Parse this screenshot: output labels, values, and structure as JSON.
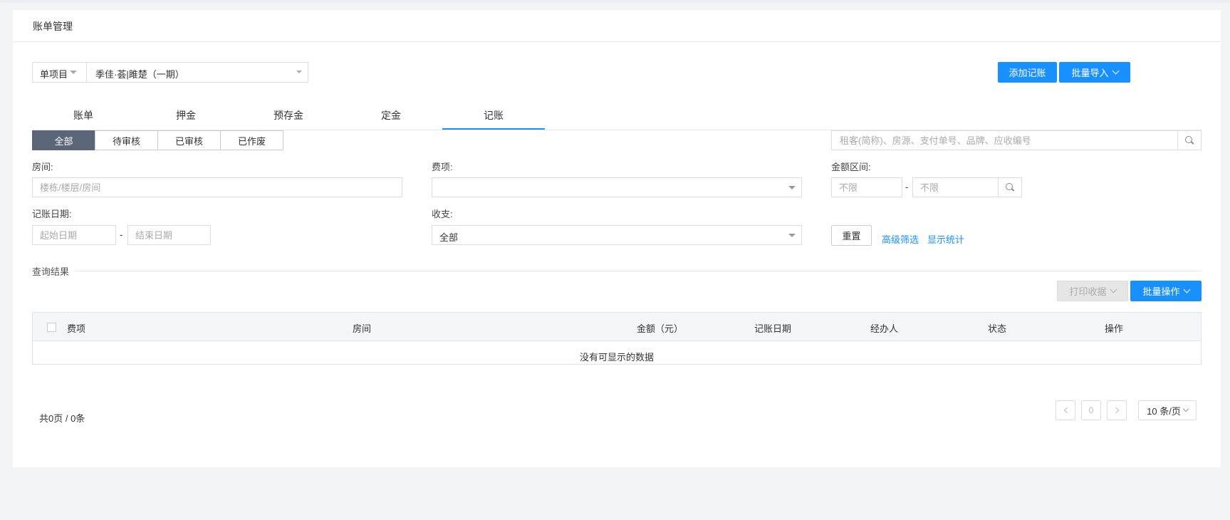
{
  "card": {
    "title": "账单管理"
  },
  "project": {
    "type": "单项目",
    "value": "季佳·荟|雎楚（一期）"
  },
  "actions": {
    "add_record": "添加记账",
    "batch_import": "批量导入"
  },
  "tabs": [
    {
      "label": "账单",
      "active": false
    },
    {
      "label": "押金",
      "active": false
    },
    {
      "label": "预存金",
      "active": false
    },
    {
      "label": "定金",
      "active": false
    },
    {
      "label": "记账",
      "active": true
    }
  ],
  "status_filter": [
    {
      "label": "全部",
      "active": true
    },
    {
      "label": "待审核",
      "active": false
    },
    {
      "label": "已审核",
      "active": false
    },
    {
      "label": "已作废",
      "active": false
    }
  ],
  "search": {
    "placeholder": "租客(简称)、房源、支付单号、品牌、应收编号"
  },
  "filters": {
    "room_label": "房间:",
    "room_placeholder": "楼栋/楼层/房间",
    "fee_label": "费项:",
    "fee_value": "",
    "amount_label": "金额区间:",
    "amount_min_placeholder": "不限",
    "amount_max_placeholder": "不限",
    "date_label": "记账日期:",
    "date_start_placeholder": "起始日期",
    "date_end_placeholder": "结束日期",
    "io_label": "收支:",
    "io_value": "全部",
    "reset": "重置",
    "advanced": "高级筛选",
    "show_stats": "显示统计",
    "dash": "-"
  },
  "results": {
    "title": "查询结果",
    "print_receipt": "打印收据",
    "batch_ops": "批量操作"
  },
  "table": {
    "columns": [
      "费项",
      "房间",
      "金额（元）",
      "记账日期",
      "经办人",
      "状态",
      "操作"
    ],
    "empty_text": "没有可显示的数据"
  },
  "pagination": {
    "total": "共0页 / 0条",
    "current_page": "0",
    "page_size": "10 条/页"
  }
}
